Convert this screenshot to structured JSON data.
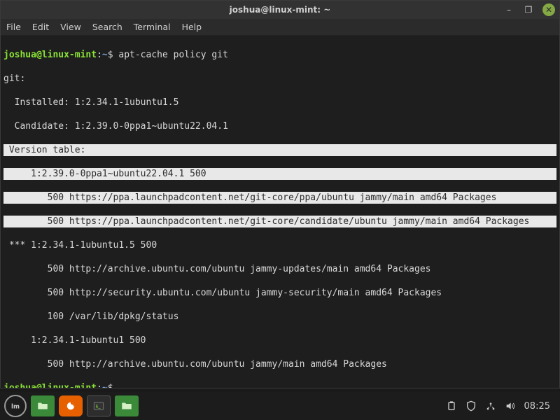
{
  "window": {
    "title": "joshua@linux-mint: ~"
  },
  "menu": {
    "file": "File",
    "edit": "Edit",
    "view": "View",
    "search": "Search",
    "terminal": "Terminal",
    "help": "Help"
  },
  "prompt": {
    "user_host": "joshua@linux-mint",
    "sep": ":",
    "path": "~",
    "symbol": "$"
  },
  "terminal": {
    "command": "apt-cache policy git",
    "lines": {
      "l0": "git:",
      "l1": "  Installed: 1:2.34.1-1ubuntu1.5",
      "l2": "  Candidate: 1:2.39.0-0ppa1~ubuntu22.04.1",
      "l3": " Version table:",
      "l4": "     1:2.39.0-0ppa1~ubuntu22.04.1 500",
      "l5": "        500 https://ppa.launchpadcontent.net/git-core/ppa/ubuntu jammy/main amd64 Packages",
      "l6": "        500 https://ppa.launchpadcontent.net/git-core/candidate/ubuntu jammy/main amd64 Packages",
      "l7": " *** 1:2.34.1-1ubuntu1.5 500",
      "l8": "        500 http://archive.ubuntu.com/ubuntu jammy-updates/main amd64 Packages",
      "l9": "        500 http://security.ubuntu.com/ubuntu jammy-security/main amd64 Packages",
      "l10": "        100 /var/lib/dpkg/status",
      "l11": "     1:2.34.1-1ubuntu1 500",
      "l12": "        500 http://archive.ubuntu.com/ubuntu jammy/main amd64 Packages"
    }
  },
  "taskbar": {
    "clock": "08:25"
  },
  "icons": {
    "minimize": "–",
    "maximize": "❐",
    "close": "✕",
    "start": "LM",
    "clipboard": "clipboard-icon",
    "shield": "shield-icon",
    "network": "network-icon",
    "volume": "volume-icon"
  }
}
